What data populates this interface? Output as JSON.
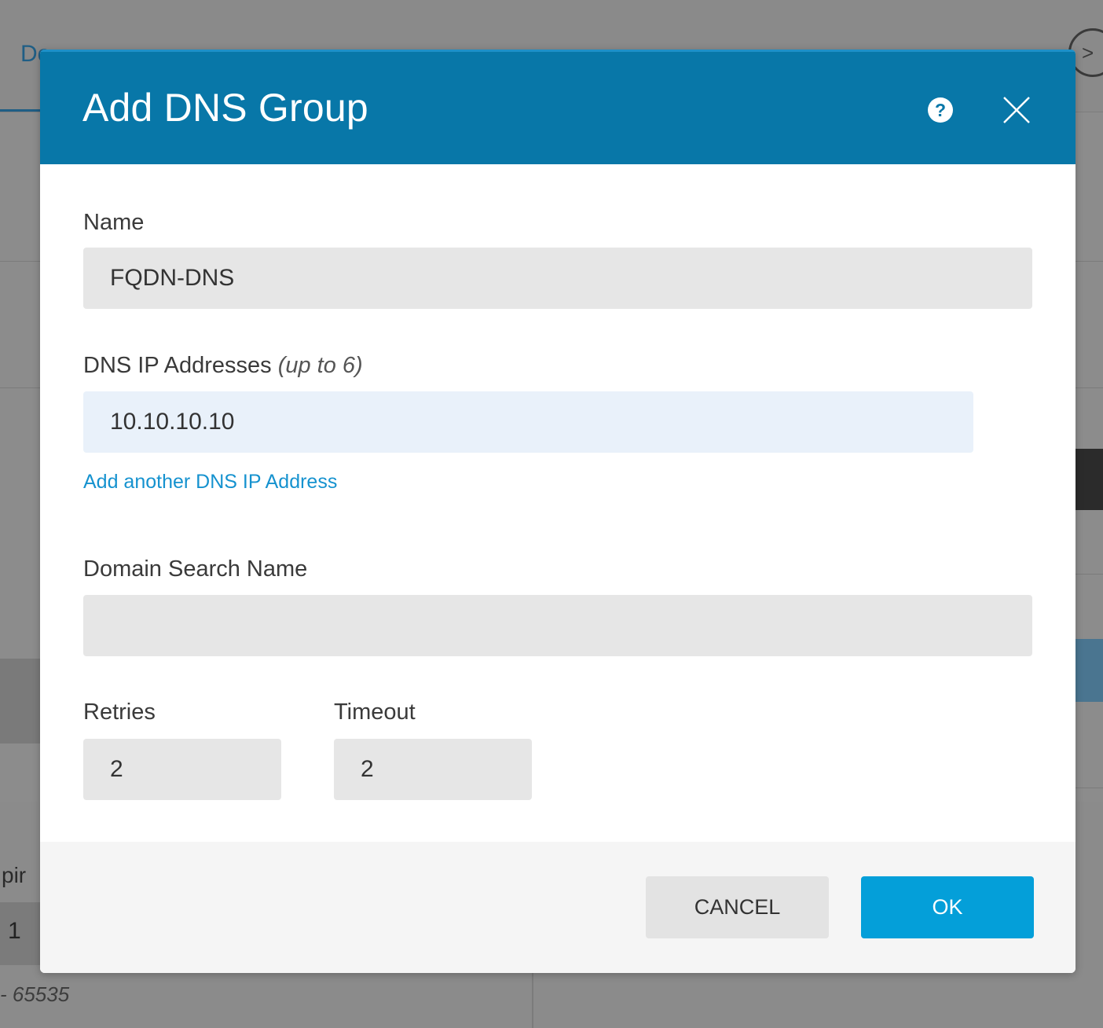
{
  "background": {
    "tab_label": "Do",
    "expiry_fragment": "pir",
    "field_value": "1",
    "range_fragment": "- 65535"
  },
  "modal": {
    "title": "Add DNS Group",
    "help_icon": "question-circle-icon",
    "close_icon": "close-x-icon",
    "header_color": "#0877a8"
  },
  "form": {
    "name": {
      "label": "Name",
      "value": "FQDN-DNS"
    },
    "dns_ips": {
      "label": "DNS IP Addresses",
      "hint": "(up to 6)",
      "values": [
        "10.10.10.10"
      ],
      "add_link": "Add another DNS IP Address"
    },
    "domain_search": {
      "label": "Domain Search Name",
      "value": ""
    },
    "retries": {
      "label": "Retries",
      "value": "2"
    },
    "timeout": {
      "label": "Timeout",
      "value": "2"
    }
  },
  "footer": {
    "cancel_label": "CANCEL",
    "ok_label": "OK",
    "ok_color": "#049fd9"
  }
}
